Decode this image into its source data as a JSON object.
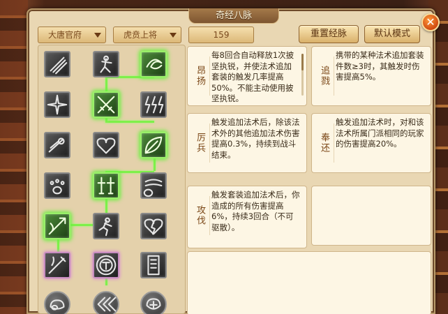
{
  "window": {
    "title": "奇经八脉",
    "close_label": "✕"
  },
  "filters": {
    "sect": "大唐官府",
    "rank": "虎贲上将",
    "points": "159"
  },
  "buttons": {
    "reset": "重置经脉",
    "default_mode": "默认模式"
  },
  "tree": {
    "columns": 3,
    "rows": 7,
    "nodes": [
      {
        "row": 0,
        "col": 0,
        "icon": "claw-slash-icon",
        "active": false
      },
      {
        "row": 0,
        "col": 1,
        "icon": "warrior-strike-icon",
        "active": false
      },
      {
        "row": 0,
        "col": 2,
        "icon": "crescent-swirl-icon",
        "active": true
      },
      {
        "row": 1,
        "col": 0,
        "icon": "burst-star-icon",
        "active": false
      },
      {
        "row": 1,
        "col": 1,
        "icon": "crossed-blades-icon",
        "active": true
      },
      {
        "row": 1,
        "col": 2,
        "icon": "lightning-strikes-icon",
        "active": false
      },
      {
        "row": 2,
        "col": 0,
        "icon": "comet-slash-icon",
        "active": false
      },
      {
        "row": 2,
        "col": 1,
        "icon": "heart-shield-icon",
        "active": false
      },
      {
        "row": 2,
        "col": 2,
        "icon": "leaf-blade-icon",
        "active": true
      },
      {
        "row": 3,
        "col": 0,
        "icon": "paw-print-icon",
        "active": false
      },
      {
        "row": 3,
        "col": 1,
        "icon": "twin-warriors-icon",
        "active": true
      },
      {
        "row": 3,
        "col": 2,
        "icon": "fist-wind-icon",
        "active": false
      },
      {
        "row": 4,
        "col": 0,
        "icon": "dragon-sword-icon",
        "active": true
      },
      {
        "row": 4,
        "col": 1,
        "icon": "running-figure-icon",
        "active": false
      },
      {
        "row": 4,
        "col": 2,
        "icon": "broken-heart-icon",
        "active": false
      },
      {
        "row": 5,
        "col": 0,
        "icon": "sword-flame-icon",
        "active": false
      },
      {
        "row": 5,
        "col": 1,
        "icon": "emblem-seal-icon",
        "active": false
      },
      {
        "row": 5,
        "col": 2,
        "icon": "talisman-scroll-icon",
        "active": false
      },
      {
        "row": 6,
        "col": 0,
        "icon": "cloud-swirl-icon",
        "active": false
      },
      {
        "row": 6,
        "col": 1,
        "icon": "chevrons-left-icon",
        "active": false
      },
      {
        "row": 6,
        "col": 2,
        "icon": "cloud-knot-icon",
        "active": false
      }
    ]
  },
  "effects": [
    {
      "name": "昂扬",
      "text": "每8回合自动释放1次披坚执锐，并使法术追加套装的触发几率提高50%。不能主动使用披坚执锐。",
      "scroll": true
    },
    {
      "name": "追戮",
      "text": "携带的某种法术追加套装件数≥3时，其触发时伤害提高5%。",
      "scroll": false
    },
    {
      "name": "厉兵",
      "text": "触发追加法术后，除该法术外的其他追加法术伤害提高0.3%，持续到战斗结束。",
      "scroll": false
    },
    {
      "name": "奉还",
      "text": "触发追加法术时，对和该法术所属门派相同的玩家的伤害提高20%。",
      "scroll": false
    },
    {
      "name": "攻伐",
      "text": "触发套装追加法术后，你造成的所有伤害提高6%，持续3回合（不可驱散）。",
      "scroll": false
    }
  ],
  "colors": {
    "panel_bg": "#e9d7b3",
    "active_glow": "#6ef043",
    "card_bg": "#fdf6e4",
    "label_text": "#7a4616"
  }
}
